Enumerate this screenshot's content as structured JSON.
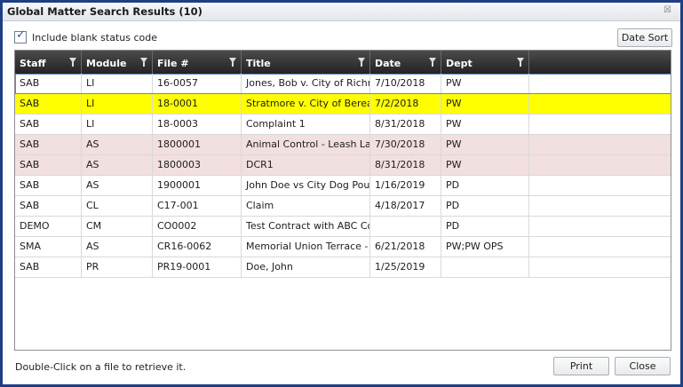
{
  "window": {
    "title": "Global Matter Search Results (10)",
    "close_glyph": "☒"
  },
  "options": {
    "include_blank_label": "Include blank status code",
    "include_blank_checked": true,
    "date_sort_label": "Date Sort"
  },
  "grid": {
    "columns": [
      "Staff",
      "Module",
      "File #",
      "Title",
      "Date",
      "Dept"
    ],
    "rows": [
      {
        "staff": "SAB",
        "module": "LI",
        "file": "16-0057",
        "title": "Jones, Bob v. City of Richm",
        "date": "7/10/2018",
        "dept": "PW",
        "style": "focus"
      },
      {
        "staff": "SAB",
        "module": "LI",
        "file": "18-0001",
        "title": "Stratmore v. City of Berea",
        "date": "7/2/2018",
        "dept": "PW",
        "style": "selected"
      },
      {
        "staff": "SAB",
        "module": "LI",
        "file": "18-0003",
        "title": "Complaint 1",
        "date": "8/31/2018",
        "dept": "PW",
        "style": "normal"
      },
      {
        "staff": "SAB",
        "module": "AS",
        "file": "1800001",
        "title": "Animal Control - Leash Lav",
        "date": "7/30/2018",
        "dept": "PW",
        "style": "pink"
      },
      {
        "staff": "SAB",
        "module": "AS",
        "file": "1800003",
        "title": "DCR1",
        "date": "8/31/2018",
        "dept": "PW",
        "style": "pink"
      },
      {
        "staff": "SAB",
        "module": "AS",
        "file": "1900001",
        "title": "John Doe vs City Dog Pour",
        "date": "1/16/2019",
        "dept": "PD",
        "style": "normal"
      },
      {
        "staff": "SAB",
        "module": "CL",
        "file": "C17-001",
        "title": "Claim",
        "date": "4/18/2017",
        "dept": "PD",
        "style": "normal"
      },
      {
        "staff": "DEMO",
        "module": "CM",
        "file": "CO0002",
        "title": "Test Contract with ABC Co",
        "date": "",
        "dept": "PD",
        "style": "normal"
      },
      {
        "staff": "SMA",
        "module": "AS",
        "file": "CR16-0062",
        "title": "Memorial Union Terrace -",
        "date": "6/21/2018",
        "dept": "PW;PW OPS",
        "style": "normal"
      },
      {
        "staff": "SAB",
        "module": "PR",
        "file": "PR19-0001",
        "title": "Doe, John",
        "date": "1/25/2019",
        "dept": "",
        "style": "normal"
      }
    ]
  },
  "footer": {
    "hint": "Double-Click on a file to retrieve it.",
    "print_label": "Print",
    "close_label": "Close"
  },
  "colors": {
    "selected_row": "#ffff00",
    "pink_row": "#f2dfdf",
    "window_border": "#1f3e86"
  }
}
